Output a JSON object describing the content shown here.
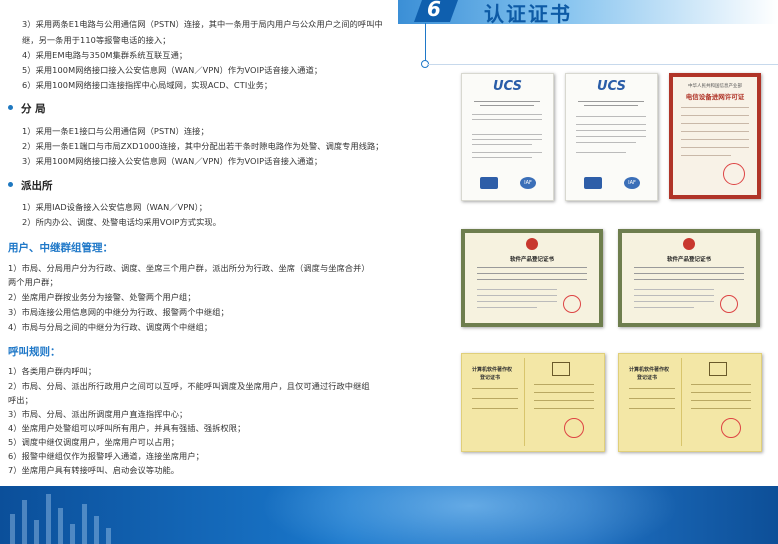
{
  "header": {
    "number": "6",
    "title": "认证证书"
  },
  "top_list": [
    "3）采用两条E1电路与公用通信网（PSTN）连接，其中一条用于局内用户与公众用户之间的呼叫中",
    "    继，另一条用于110等报警电话的接入；",
    "4）采用EM电路与350M集群系统互联互通；",
    "5）采用100M网络接口接入公安信息网（WAN／VPN）作为VOIP话音接入通道；",
    "6）采用100M网络接口连接指挥中心局域网，实现ACD、CTI业务；"
  ],
  "fenju": {
    "title": "分  局",
    "items": [
      "1）采用一条E1接口与公用通信网（PSTN）连接；",
      "2）采用一条E1端口与市局ZXD1000连接，其中分配出若干条时隙电路作为处警、调度专用线路；",
      "3）采用100M网络接口接入公安信息网（WAN／VPN）作为VOIP话音接入通道；"
    ]
  },
  "paichusuo": {
    "title": "派出所",
    "items": [
      "1）采用IAD设备接入公安信息网（WAN／VPN）；",
      "2）所内办公、调度、处警电话均采用VOIP方式实现。"
    ]
  },
  "user_trunk": {
    "title": "用户、中继群组管理：",
    "items": [
      "1）市局、分局用户分为行政、调度、坐席三个用户群，派出所分为行政、坐席（调度与坐席合并）",
      "    两个用户群；",
      "2）坐席用户群按业务分为接警、处警两个用户组；",
      "3）市局连接公用信息网的中继分为行政、报警两个中继组；",
      "4）市局与分局之间的中继分为行政、调度两个中继组；"
    ]
  },
  "call_rules": {
    "title": "呼叫规则：",
    "items": [
      "1）各类用户群内呼叫；",
      "2）市局、分局、派出所行政用户之间可以互呼，不能呼叫调度及坐席用户，且仅可通过行政中继组",
      "    呼出；",
      "3）市局、分局、派出所调度用户直连指挥中心；",
      "4）坐席用户处警组可以呼叫所有用户，并具有强插、强拆权限；",
      "5）调度中继仅调度用户，坐席用户可以占用；",
      "6）报警中继组仅作为报警呼入通道，连接坐席用户；",
      "7）坐席用户具有转接呼叫、启动会议等功能。"
    ]
  },
  "certificates": {
    "ucs_logo": "UCS",
    "iaf_logo": "IAF",
    "license_title_line": "中华人民共和国信息产业部",
    "license_title": "电信设备进网许可证",
    "software_title": "软件产品登记证书",
    "copyright_title_1": "计算机软件著作权",
    "copyright_title_2": "登记证书"
  },
  "colors": {
    "accent_blue": "#1f78c8",
    "band_blue": "#1a78cc",
    "license_red": "#b03428",
    "cert_yellow": "#f3e7a6"
  }
}
